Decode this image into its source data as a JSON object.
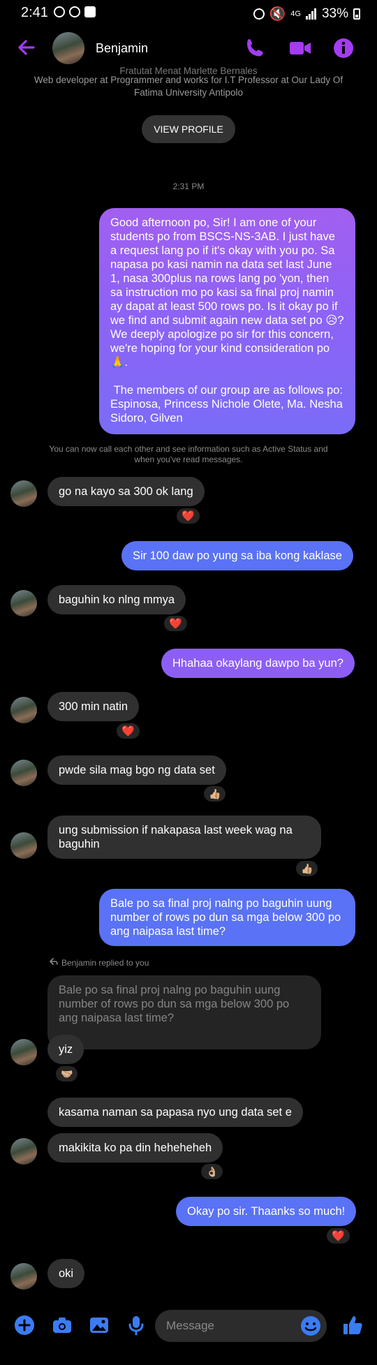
{
  "status": {
    "time": "2:41",
    "network": "4G",
    "battery": "33%"
  },
  "header": {
    "contact_name": "Benjamin"
  },
  "profile": {
    "cut_line": "Fratutat Menat Marlette Bernales",
    "line1": "Web developer at Programmer and works for I.T Professor at Our Lady Of",
    "line2": "Fatima University Antipolo",
    "view_profile": "VIEW PROFILE"
  },
  "timestamp": "2:31 PM",
  "messages": {
    "m1": "Good afternoon po, Sir! I am one of your students po from BSCS-NS-3AB. I just have a request lang po if it's okay with you po. Sa napasa po kasi namin na data set last June 1, nasa 300plus na rows lang po 'yon, then sa instruction mo po kasi sa final proj namin ay dapat at least 500 rows po. Is it okay po if we find and submit again new data set po 😥? We deeply apologize po sir for this concern, we're hoping for your kind consideration po🙏.\n\n The members of our group are as follows po: Espinosa, Princess Nichole Olete, Ma. Nesha Sidoro, Gilven",
    "notice": "You can now call each other and see information such as Active Status and when you've read messages.",
    "m2": "go na kayo sa 300 ok lang",
    "m3": "Sir 100 daw po yung sa iba kong kaklase",
    "m4": "baguhin ko nlng mmya",
    "m5": "Hhahaa okaylang dawpo ba yun?",
    "m6": "300 min natin",
    "m7": "pwde sila mag bgo ng data set",
    "m8": "ung submission if nakapasa last week wag na baguhin",
    "m9": "Bale po sa final proj nalng po baguhin uung number of rows po dun sa mga below 300 po ang naipasa last time?",
    "reply_label": "Benjamin replied to you",
    "quoted": "Bale po sa final proj nalng po baguhin uung number of rows po dun sa mga below 300 po ang naipasa last time?",
    "m10": "yiz",
    "m11": "kasama naman sa papasa nyo ung data set e",
    "m12": "makikita ko pa din heheheheh",
    "m13": "Okay po sir. Thaanks so much!",
    "m14": "oki"
  },
  "reactions": {
    "heart": "❤️",
    "thumbs": "👍🏼",
    "hands": "🤝🏼",
    "ok": "👌🏼"
  },
  "composer": {
    "placeholder": "Message"
  },
  "colors": {
    "accent": "#a33cf2",
    "bubble_blue": "#5a72f5",
    "bubble_purple": "#9a5cf2",
    "received": "#303030"
  }
}
